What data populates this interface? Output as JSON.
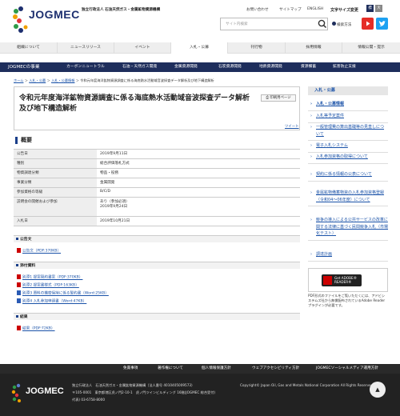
{
  "header": {
    "org_line": "独立行政法人 石油天然ガス・金属鉱物資源機構",
    "logo_text": "JOGMEC",
    "toplinks": [
      "お問い合わせ",
      "サイトマップ",
      "ENGLISH"
    ],
    "text_size_label": "文字サイズ変更",
    "text_sizes": [
      "標",
      "大"
    ],
    "search_placeholder": "サイト内検索",
    "adv_search": "検索方法"
  },
  "gnav": [
    "組織について",
    "ニュースリリース",
    "イベント",
    "入札・公募",
    "刊行物",
    "採用情報",
    "情報公開・提示"
  ],
  "biz": {
    "title": "JOGMECの事業",
    "items": [
      "カーボンニュートラル",
      "石油・天然ガス開発",
      "金属資源開発",
      "石炭資源開発",
      "地熱資源開発",
      "資源備蓄",
      "鉱害防止支援"
    ]
  },
  "breadcrumb": [
    "ホーム",
    "入札・公募",
    "入札・公募情報",
    "令和元年度海洋鉱物資源調査に係る海底熱水活動域音波探査データ解析及び地下構造解析"
  ],
  "page": {
    "title": "令和元年度海洋鉱物資源調査に係る海底熱水活動域音波探査データ解析及び地下構造解析",
    "print_label": "印刷用ページ",
    "tweet": "ツイート",
    "gaiyo": "概要"
  },
  "info_rows": [
    {
      "k": "公告日",
      "v": "2019年9月11日"
    },
    {
      "k": "種別",
      "v": "総合評価落札方式"
    },
    {
      "k": "物資調達分類",
      "v": "物品・役務"
    },
    {
      "k": "事業分類",
      "v": "金属開発"
    },
    {
      "k": "参加資格の等級",
      "v": "B/C/D"
    },
    {
      "k": "説明会の開催および参加",
      "v": "あり（参加必須）",
      "v2": "2019年9月24日"
    },
    {
      "k": "入札日",
      "v": "2019年10月21日"
    }
  ],
  "sections": {
    "koukoku": {
      "title": "公告文",
      "links": [
        "公告文（PDF:370KB）"
      ]
    },
    "tenpu": {
      "title": "添付資料",
      "links": [
        "別添1 提案契約書案（PDF:370KB）",
        "別添2 提案書様式（PDF:163KB）",
        "別添3 資料の機密保持に係る誓約書（Word:25KB）",
        "別添4 入札参加申請書（Word:47KB）"
      ]
    },
    "kekka": {
      "title": "結果",
      "links": [
        "結果（PDF:72KB）"
      ]
    }
  },
  "sidebar": {
    "top": "入札・公募",
    "items": [
      "入札・公募情報",
      "入札等予定案件",
      "一般管理費の算出基礎等の見直しについて",
      "電子入札システム",
      "入札参加資格の取得について",
      "契約に係る情報の公表について",
      "金属鉱物備蓄物資の入札参加資格登録（令和04〜06年度）について",
      "競争の導入による公共サービスの改革に関する法律に基づく民間競争入札（市場化テスト）",
      "調達計画"
    ],
    "adobe_badge": "Get ADOBE® READER®",
    "adobe_text": "PDF形式のファイルをご覧いただくには、アドビシステムズ社から無償配布されているAdobe Readerプラグインが必要です。"
  },
  "footer": {
    "links": [
      "免責事項",
      "著作権について",
      "個人情報保護方針",
      "ウェブアクセシビリティ方針",
      "JOGMECソーシャルメディア運用方針"
    ],
    "logo_text": "JOGMEC",
    "org": "独立行政法人　石油天然ガス・金属鉱物資源機構（法人番号 4010405009573）",
    "address": "〒105-0001　東京都港区虎ノ門2-10-1　虎ノ門ツインビルディング 16階(JOGMEC 総合受付)",
    "tel": "代表) 03-6758-8000",
    "copyright": "Copyright© Japan Oil, Gas and Metals National Corporation All Rights Reserved.",
    "pagetop": "▲"
  },
  "colors": {
    "brand_navy": "#1e2e5c",
    "link": "#1a52a8",
    "youtube": "#e52d27",
    "twitter": "#1da1f2"
  }
}
